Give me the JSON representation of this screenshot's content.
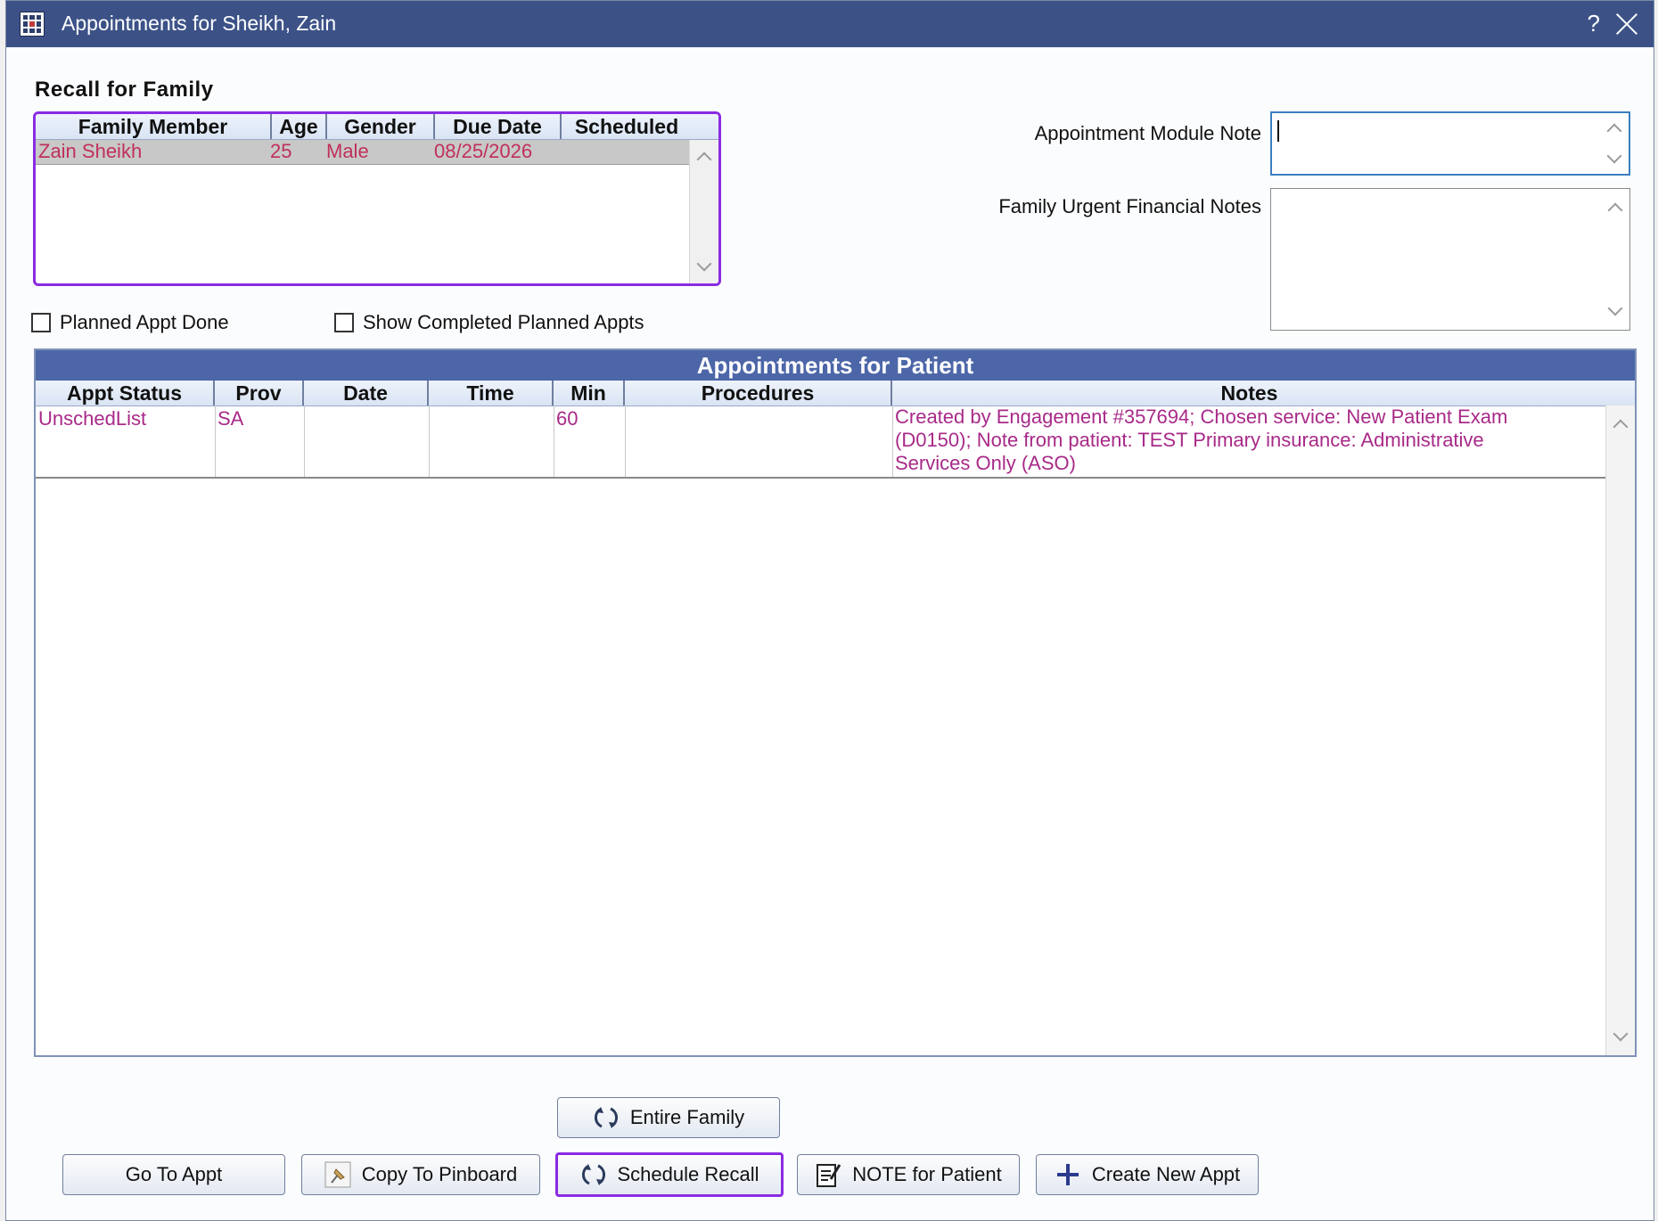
{
  "window": {
    "title": "Appointments for Sheikh, Zain",
    "help_label": "?"
  },
  "recall": {
    "section_title": "Recall for Family",
    "columns": [
      "Family Member",
      "Age",
      "Gender",
      "Due Date",
      "Scheduled"
    ],
    "rows": [
      {
        "member": "Zain Sheikh",
        "age": "25",
        "gender": "Male",
        "due_date": "08/25/2026",
        "scheduled": ""
      }
    ]
  },
  "notes": {
    "appt_module_note_label": "Appointment Module Note",
    "appt_module_note_value": "",
    "family_urgent_label": "Family Urgent Financial Notes",
    "family_urgent_value": ""
  },
  "checkboxes": {
    "planned_done": "Planned Appt Done",
    "show_completed": "Show Completed Planned Appts"
  },
  "appointments": {
    "title": "Appointments for Patient",
    "columns": [
      "Appt Status",
      "Prov",
      "Date",
      "Time",
      "Min",
      "Procedures",
      "Notes"
    ],
    "rows": [
      {
        "status": "UnschedList",
        "prov": "SA",
        "date": "",
        "time": "",
        "min": "60",
        "procedures": "",
        "notes_line1": "Created by Engagement #357694; Chosen service: New Patient Exam",
        "notes_line2": "(D0150); Note from patient: TEST  Primary insurance: Administrative",
        "notes_line3": "Services Only (ASO)"
      }
    ]
  },
  "buttons": {
    "entire_family": "Entire Family",
    "go_to_appt": "Go To Appt",
    "copy_to_pinboard": "Copy To Pinboard",
    "schedule_recall": "Schedule Recall",
    "note_for_patient": "NOTE for Patient",
    "create_new_appt": "Create New Appt"
  },
  "colors": {
    "titlebar": "#3c5287",
    "focus_outline": "#8a2be2",
    "recall_text": "#c0305a",
    "appt_text": "#a82a88"
  }
}
